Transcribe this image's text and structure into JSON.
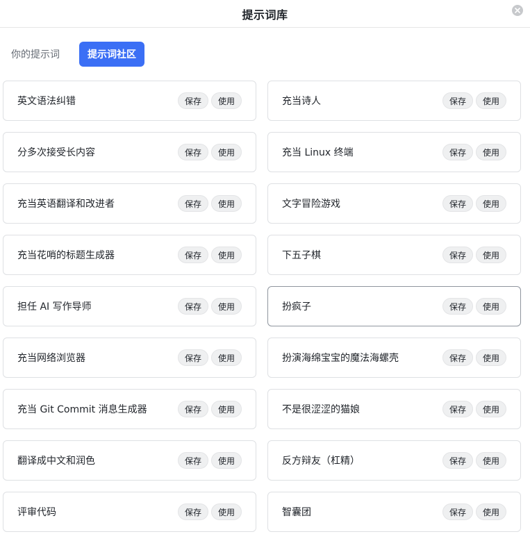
{
  "window": {
    "title": "提示词库"
  },
  "tabs": [
    {
      "label": "你的提示词",
      "active": false
    },
    {
      "label": "提示词社区",
      "active": true
    }
  ],
  "actions": {
    "save_label": "保存",
    "use_label": "使用"
  },
  "prompts": [
    {
      "title": "英文语法纠错"
    },
    {
      "title": "充当诗人"
    },
    {
      "title": "分多次接受长内容"
    },
    {
      "title": "充当 Linux 终端"
    },
    {
      "title": "充当英语翻译和改进者"
    },
    {
      "title": "文字冒险游戏"
    },
    {
      "title": "充当花哨的标题生成器"
    },
    {
      "title": "下五子棋"
    },
    {
      "title": "担任 AI 写作导师"
    },
    {
      "title": "扮疯子"
    },
    {
      "title": "充当网络浏览器"
    },
    {
      "title": "扮演海绵宝宝的魔法海螺壳"
    },
    {
      "title": "充当 Git Commit 消息生成器"
    },
    {
      "title": "不是很涩涩的猫娘"
    },
    {
      "title": "翻译成中文和润色"
    },
    {
      "title": "反方辩友（杠精）"
    },
    {
      "title": "评审代码"
    },
    {
      "title": "智囊团"
    }
  ],
  "colors": {
    "accent": "#3b6ff5",
    "card_border": "#dee0e3",
    "card_border_hover": "#8f959e"
  },
  "icons": {
    "close": "close-icon"
  }
}
